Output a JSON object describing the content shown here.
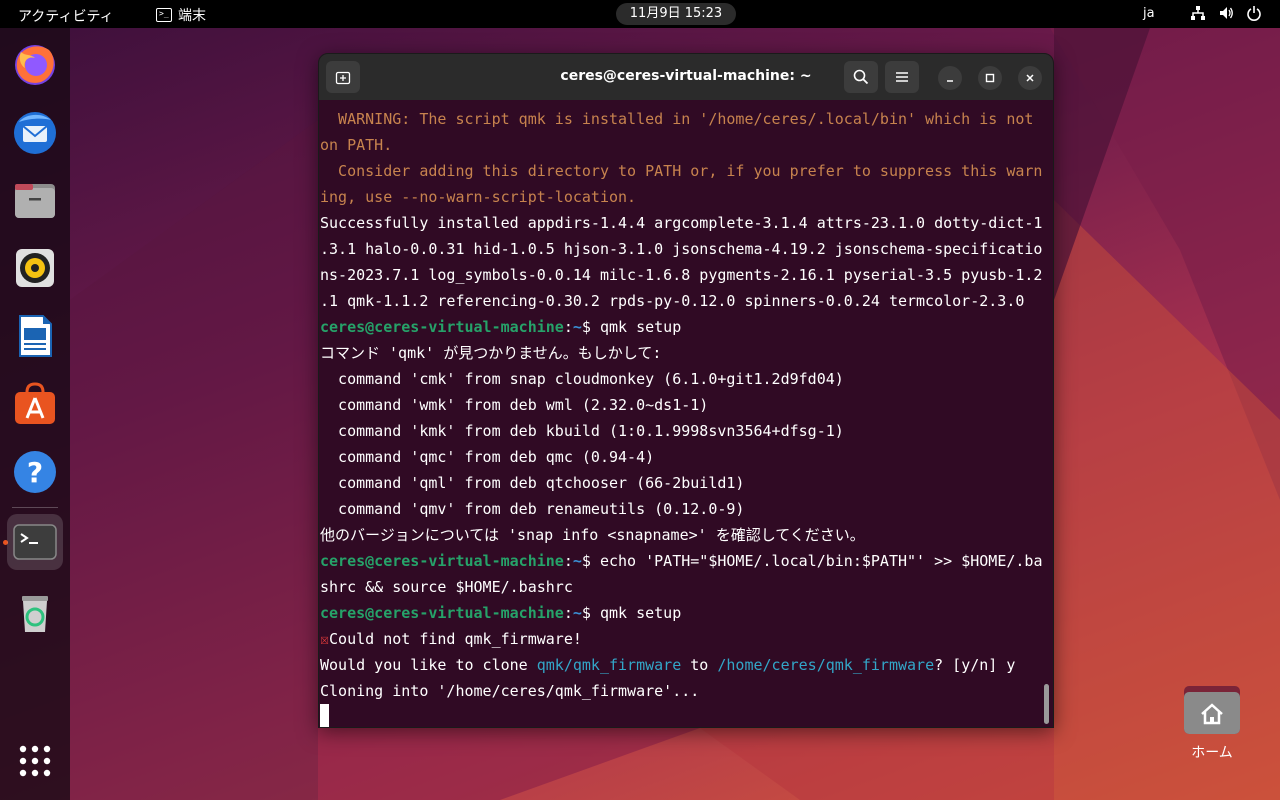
{
  "topbar": {
    "activities": "アクティビティ",
    "app_name": "端末",
    "clock": "11月9日  15:23",
    "lang": "ja"
  },
  "dock": {
    "items": [
      {
        "name": "firefox-icon"
      },
      {
        "name": "thunderbird-icon"
      },
      {
        "name": "files-icon"
      },
      {
        "name": "rhythmbox-icon"
      },
      {
        "name": "libreoffice-writer-icon"
      },
      {
        "name": "app-center-icon"
      },
      {
        "name": "help-icon"
      },
      {
        "name": "terminal-icon"
      },
      {
        "name": "trash-icon"
      }
    ]
  },
  "desktop": {
    "home_label": "ホーム"
  },
  "terminal": {
    "title": "ceres@ceres-virtual-machine: ~",
    "colors": {
      "background": "#300a24",
      "warning": "#c7834e",
      "prompt_user": "#26a269",
      "prompt_path": "#3a8fd4",
      "link": "#33a6c8"
    },
    "prompt_user": "ceres@ceres-virtual-machine",
    "prompt_sep": ":",
    "prompt_path": "~",
    "prompt_dollar": "$ ",
    "lines": {
      "l1": "  WARNING: The script qmk is installed in '/home/ceres/.local/bin' which is not",
      "l2": "on PATH.",
      "l3": "  Consider adding this directory to PATH or, if you prefer to suppress this warn",
      "l4": "ing, use --no-warn-script-location.",
      "l5": "Successfully installed appdirs-1.4.4 argcomplete-3.1.4 attrs-23.1.0 dotty-dict-1",
      "l6": ".3.1 halo-0.0.31 hid-1.0.5 hjson-3.1.0 jsonschema-4.19.2 jsonschema-specificatio",
      "l7": "ns-2023.7.1 log_symbols-0.0.14 milc-1.6.8 pygments-2.16.1 pyserial-3.5 pyusb-1.2",
      "l8": ".1 qmk-1.1.2 referencing-0.30.2 rpds-py-0.12.0 spinners-0.0.24 termcolor-2.3.0",
      "cmd1": "qmk setup",
      "l10": "コマンド 'qmk' が見つかりません。もしかして:",
      "l11": "  command 'cmk' from snap cloudmonkey (6.1.0+git1.2d9fd04)",
      "l12": "  command 'wmk' from deb wml (2.32.0~ds1-1)",
      "l13": "  command 'kmk' from deb kbuild (1:0.1.9998svn3564+dfsg-1)",
      "l14": "  command 'qmc' from deb qmc (0.94-4)",
      "l15": "  command 'qml' from deb qtchooser (66-2build1)",
      "l16": "  command 'qmv' from deb renameutils (0.12.0-9)",
      "l17": "他のバージョンについては 'snap info <snapname>' を確認してください。",
      "cmd2": "echo 'PATH=\"$HOME/.local/bin:$PATH\"' >> $HOME/.ba",
      "l19": "shrc && source $HOME/.bashrc",
      "cmd3": "qmk setup",
      "err_mark": "☒",
      "l21": "Could not find qmk_firmware!",
      "l22a": "Would you like to clone ",
      "l22b": "qmk/qmk_firmware",
      "l22c": " to ",
      "l22d": "/home/ceres/qmk_firmware",
      "l22e": "? [y/n] y",
      "l23": "Cloning into '/home/ceres/qmk_firmware'..."
    }
  }
}
